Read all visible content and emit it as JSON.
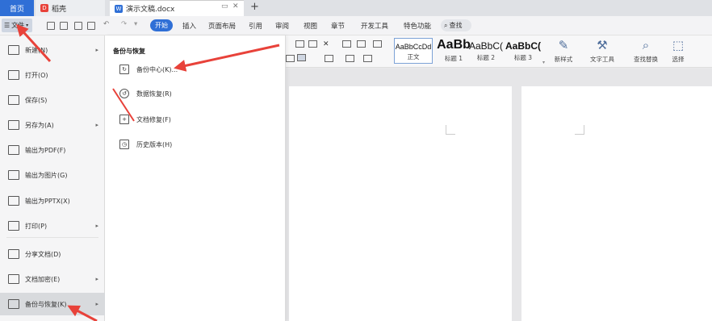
{
  "tabbar": {
    "home_label": "首页",
    "daoke_label": "稻壳",
    "doc_label": "演示文稿.docx",
    "add_label": "+"
  },
  "menu": {
    "file_label": "文件",
    "start_label": "开始",
    "items": [
      "插入",
      "页面布局",
      "引用",
      "审阅",
      "视图",
      "章节",
      "开发工具",
      "特色功能"
    ],
    "search_label": "查找"
  },
  "ribbon": {
    "styles": [
      {
        "sample": "AaBbCcDd",
        "label": "正文"
      },
      {
        "sample": "AaBb",
        "label": "标题 1"
      },
      {
        "sample": "AaBbC(",
        "label": "标题 2"
      },
      {
        "sample": "AaBbC(",
        "label": "标题 3"
      }
    ],
    "tools": [
      {
        "label": "新样式",
        "icon": "new-style-icon"
      },
      {
        "label": "文字工具",
        "icon": "text-tool-icon"
      },
      {
        "label": "查找替换",
        "icon": "find-replace-icon"
      },
      {
        "label": "选择",
        "icon": "select-icon"
      }
    ]
  },
  "leftmenu": {
    "items": [
      {
        "label": "新建(N)",
        "arrow": true
      },
      {
        "label": "打开(O)",
        "arrow": false
      },
      {
        "label": "保存(S)",
        "arrow": false
      },
      {
        "label": "另存为(A)",
        "arrow": true
      },
      {
        "label": "输出为PDF(F)",
        "arrow": false
      },
      {
        "label": "输出为图片(G)",
        "arrow": false
      },
      {
        "label": "输出为PPTX(X)",
        "arrow": false
      },
      {
        "label": "打印(P)",
        "arrow": true
      },
      {
        "label": "分享文档(D)",
        "arrow": false
      },
      {
        "label": "文档加密(E)",
        "arrow": true
      },
      {
        "label": "备份与恢复(K)",
        "arrow": true
      }
    ]
  },
  "submenu": {
    "title": "备份与恢复",
    "items": [
      {
        "label": "备份中心(K)...",
        "icon": "backup-center-icon"
      },
      {
        "label": "数据恢复(R)",
        "icon": "data-recovery-icon"
      },
      {
        "label": "文档修复(F)",
        "icon": "doc-repair-icon"
      },
      {
        "label": "历史版本(H)",
        "icon": "history-version-icon"
      }
    ]
  },
  "colors": {
    "accent": "#2f6fd6",
    "arrow": "#e8423a"
  }
}
